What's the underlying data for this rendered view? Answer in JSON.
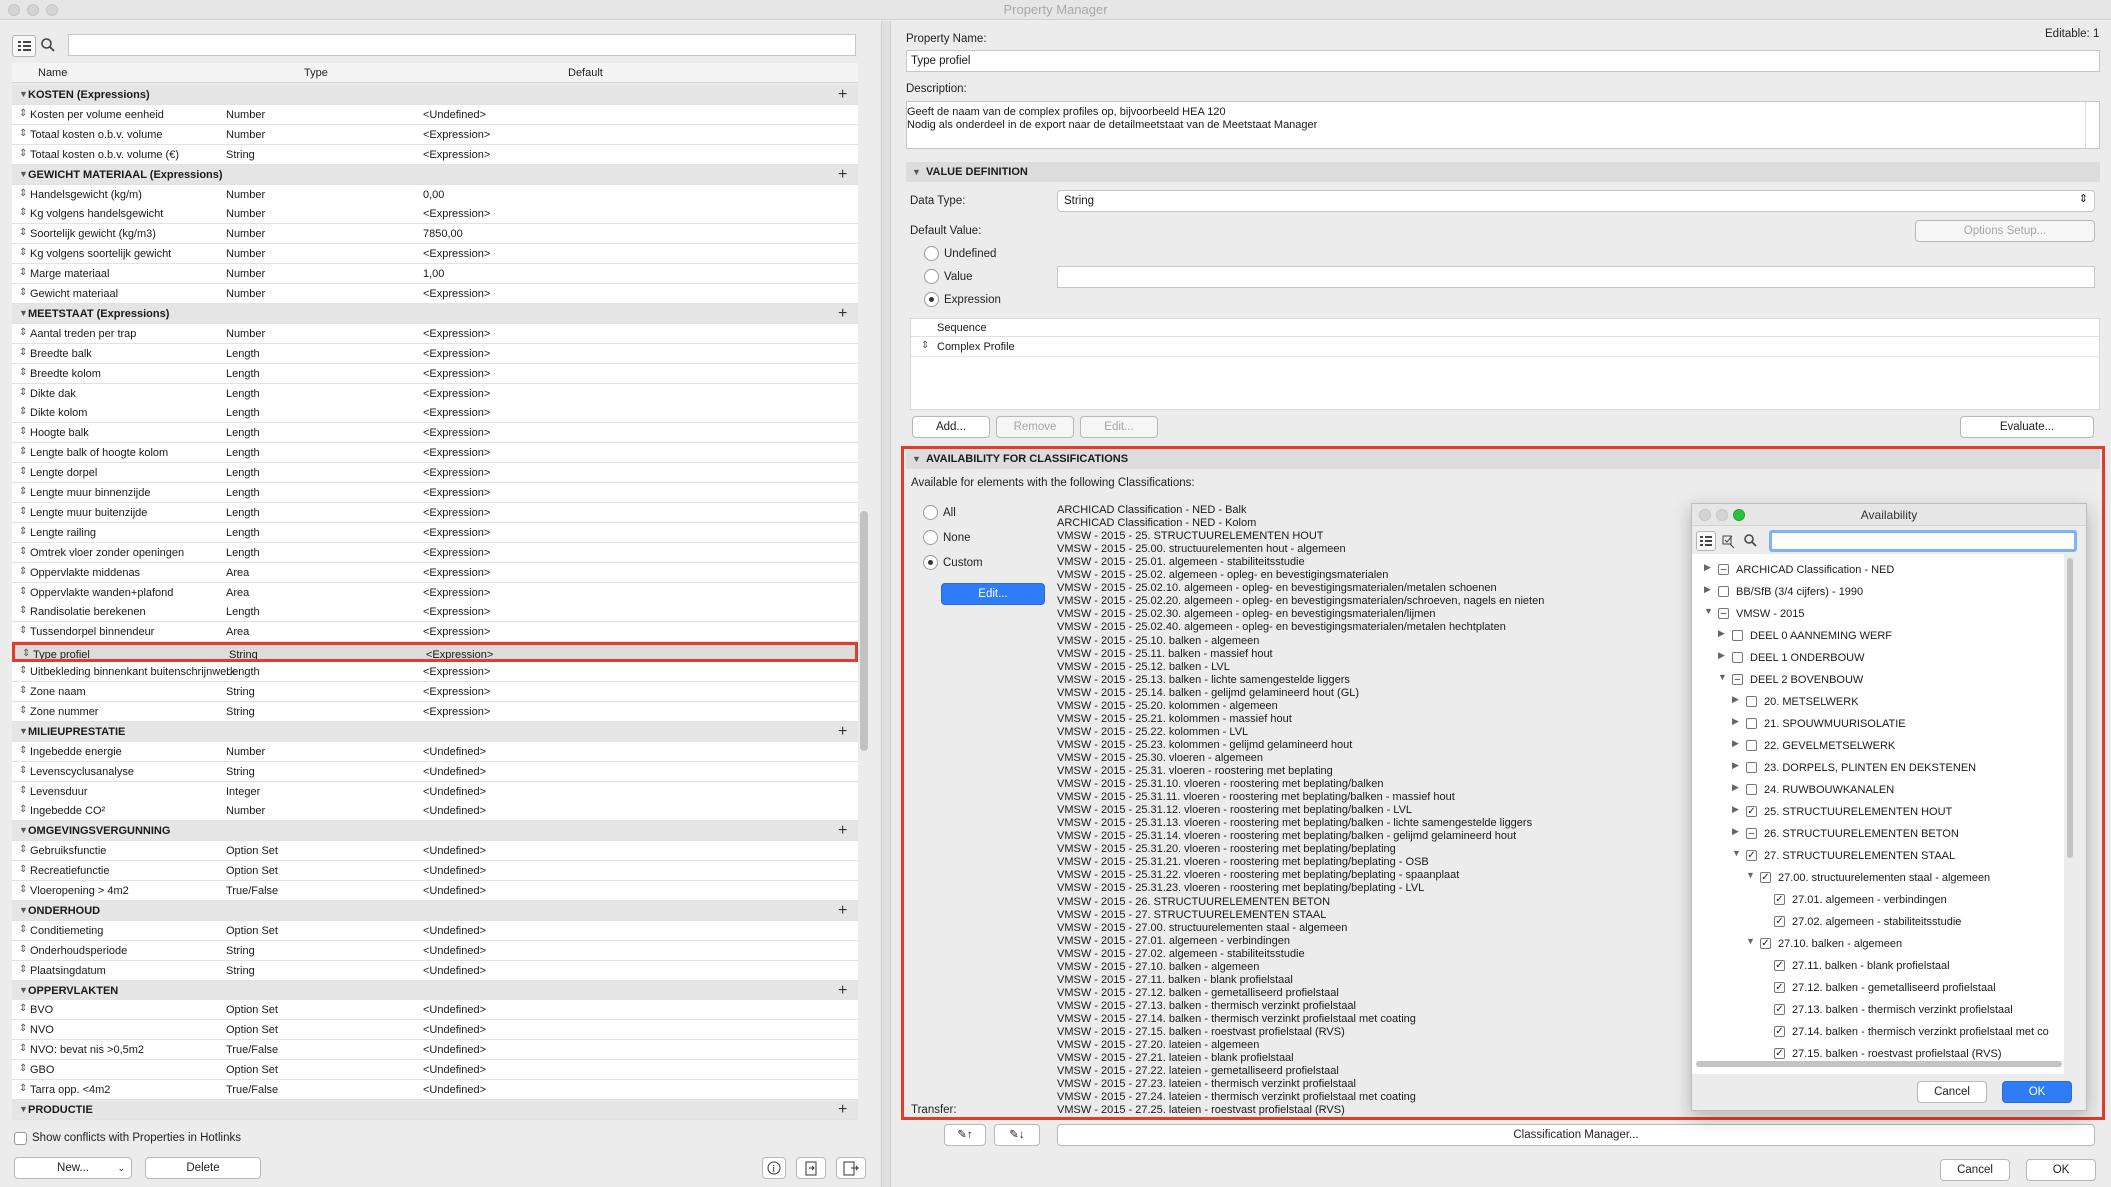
{
  "window": {
    "title": "Property Manager"
  },
  "left": {
    "columns": {
      "name": "Name",
      "type": "Type",
      "default": "Default"
    },
    "rows": [
      {
        "g": 1,
        "n": "KOSTEN (Expressions)"
      },
      {
        "n": "Kosten per volume eenheid",
        "t": "Number",
        "d": "<Undefined>"
      },
      {
        "n": "Totaal kosten o.b.v. volume",
        "t": "Number",
        "d": "<Expression>"
      },
      {
        "n": "Totaal kosten o.b.v. volume (€)",
        "t": "String",
        "d": "<Expression>"
      },
      {
        "g": 1,
        "n": "GEWICHT MATERIAAL (Expressions)"
      },
      {
        "n": "Handelsgewicht (kg/m)",
        "t": "Number",
        "d": "0,00"
      },
      {
        "n": "Kg volgens handelsgewicht",
        "t": "Number",
        "d": "<Expression>"
      },
      {
        "n": "Soortelijk gewicht (kg/m3)",
        "t": "Number",
        "d": "7850,00"
      },
      {
        "n": "Kg volgens soortelijk gewicht",
        "t": "Number",
        "d": "<Expression>"
      },
      {
        "n": "Marge materiaal",
        "t": "Number",
        "d": "1,00"
      },
      {
        "n": "Gewicht materiaal",
        "t": "Number",
        "d": "<Expression>"
      },
      {
        "g": 1,
        "n": "MEETSTAAT (Expressions)"
      },
      {
        "n": "Aantal treden per trap",
        "t": "Number",
        "d": "<Expression>"
      },
      {
        "n": "Breedte balk",
        "t": "Length",
        "d": "<Expression>"
      },
      {
        "n": "Breedte kolom",
        "t": "Length",
        "d": "<Expression>"
      },
      {
        "n": "Dikte dak",
        "t": "Length",
        "d": "<Expression>"
      },
      {
        "n": "Dikte kolom",
        "t": "Length",
        "d": "<Expression>"
      },
      {
        "n": "Hoogte balk",
        "t": "Length",
        "d": "<Expression>"
      },
      {
        "n": "Lengte balk of hoogte kolom",
        "t": "Length",
        "d": "<Expression>"
      },
      {
        "n": "Lengte dorpel",
        "t": "Length",
        "d": "<Expression>"
      },
      {
        "n": "Lengte muur binnenzijde",
        "t": "Length",
        "d": "<Expression>"
      },
      {
        "n": "Lengte muur buitenzijde",
        "t": "Length",
        "d": "<Expression>"
      },
      {
        "n": "Lengte railing",
        "t": "Length",
        "d": "<Expression>"
      },
      {
        "n": "Omtrek vloer zonder openingen",
        "t": "Length",
        "d": "<Expression>"
      },
      {
        "n": "Oppervlakte middenas",
        "t": "Area",
        "d": "<Expression>"
      },
      {
        "n": "Oppervlakte wanden+plafond",
        "t": "Area",
        "d": "<Expression>"
      },
      {
        "n": "Randisolatie berekenen",
        "t": "Length",
        "d": "<Expression>"
      },
      {
        "n": "Tussendorpel binnendeur",
        "t": "Area",
        "d": "<Expression>"
      },
      {
        "n": "Type profiel",
        "t": "String",
        "d": "<Expression>",
        "sel": 1
      },
      {
        "n": "Uitbekleding binnenkant buitenschrijnwerk",
        "t": "Length",
        "d": "<Expression>"
      },
      {
        "n": "Zone naam",
        "t": "String",
        "d": "<Expression>"
      },
      {
        "n": "Zone nummer",
        "t": "String",
        "d": "<Expression>"
      },
      {
        "g": 1,
        "n": "MILIEUPRESTATIE"
      },
      {
        "n": "Ingebedde energie",
        "t": "Number",
        "d": "<Undefined>"
      },
      {
        "n": "Levenscyclusanalyse",
        "t": "String",
        "d": "<Undefined>"
      },
      {
        "n": "Levensduur",
        "t": "Integer",
        "d": "<Undefined>"
      },
      {
        "n": "Ingebedde CO²",
        "t": "Number",
        "d": "<Undefined>"
      },
      {
        "g": 1,
        "n": "OMGEVINGSVERGUNNING"
      },
      {
        "n": "Gebruiksfunctie",
        "t": "Option Set",
        "d": "<Undefined>"
      },
      {
        "n": "Recreatiefunctie",
        "t": "Option Set",
        "d": "<Undefined>"
      },
      {
        "n": "Vloeropening > 4m2",
        "t": "True/False",
        "d": "<Undefined>"
      },
      {
        "g": 1,
        "n": "ONDERHOUD"
      },
      {
        "n": "Conditiemeting",
        "t": "Option Set",
        "d": "<Undefined>"
      },
      {
        "n": "Onderhoudsperiode",
        "t": "String",
        "d": "<Undefined>"
      },
      {
        "n": "Plaatsingdatum",
        "t": "String",
        "d": "<Undefined>"
      },
      {
        "g": 1,
        "n": "OPPERVLAKTEN"
      },
      {
        "n": "BVO",
        "t": "Option Set",
        "d": "<Undefined>"
      },
      {
        "n": "NVO",
        "t": "Option Set",
        "d": "<Undefined>"
      },
      {
        "n": "NVO: bevat nis >0,5m2",
        "t": "True/False",
        "d": "<Undefined>"
      },
      {
        "n": "GBO",
        "t": "Option Set",
        "d": "<Undefined>"
      },
      {
        "n": "Tarra opp. <4m2",
        "t": "True/False",
        "d": "<Undefined>"
      },
      {
        "g": 1,
        "n": "PRODUCTIE"
      }
    ],
    "show_conflicts": "Show conflicts with Properties in Hotlinks",
    "new_label": "New...",
    "delete_label": "Delete"
  },
  "right": {
    "editable": "Editable: 1",
    "property_name_label": "Property Name:",
    "property_name": "Type profiel",
    "description_label": "Description:",
    "description_1": "Geeft de naam van de complex profiles op, bijvoorbeeld HEA 120",
    "description_2": "Nodig als onderdeel in de export naar de detailmeetstaat van de Meetstaat Manager",
    "value_definition": "VALUE DEFINITION",
    "data_type_label": "Data Type:",
    "data_type": "String",
    "default_value_label": "Default Value:",
    "options_setup": "Options Setup...",
    "r_undefined": "Undefined",
    "r_value": "Value",
    "r_expression": "Expression",
    "seq_header": "Sequence",
    "seq_item": "Complex Profile",
    "add": "Add...",
    "remove": "Remove",
    "edit": "Edit...",
    "evaluate": "Evaluate...",
    "availability": "AVAILABILITY FOR CLASSIFICATIONS",
    "available_text": "Available for elements with the following Classifications:",
    "r_all": "All",
    "r_none": "None",
    "r_custom": "Custom",
    "edit_btn": "Edit...",
    "transfer": "Transfer:",
    "classification_manager": "Classification Manager...",
    "cancel": "Cancel",
    "ok": "OK",
    "classifications": [
      "ARCHICAD Classification - NED - Balk",
      "ARCHICAD Classification - NED - Kolom",
      "VMSW - 2015 - 25. STRUCTUURELEMENTEN HOUT",
      "VMSW - 2015 - 25.00. structuurelementen hout - algemeen",
      "VMSW - 2015 - 25.01. algemeen - stabiliteitsstudie",
      "VMSW - 2015 - 25.02. algemeen - opleg- en bevestigingsmaterialen",
      "VMSW - 2015 - 25.02.10. algemeen - opleg- en bevestigingsmaterialen/metalen schoenen",
      "VMSW - 2015 - 25.02.20. algemeen - opleg- en bevestigingsmaterialen/schroeven, nagels en nieten",
      "VMSW - 2015 - 25.02.30. algemeen - opleg- en bevestigingsmaterialen/lijmen",
      "VMSW - 2015 - 25.02.40. algemeen - opleg- en bevestigingsmaterialen/metalen hechtplaten",
      "VMSW - 2015 - 25.10. balken - algemeen",
      "VMSW - 2015 - 25.11. balken - massief hout",
      "VMSW - 2015 - 25.12. balken - LVL",
      "VMSW - 2015 - 25.13. balken - lichte samengestelde liggers",
      "VMSW - 2015 - 25.14. balken - gelijmd gelamineerd hout (GL)",
      "VMSW - 2015 - 25.20. kolommen - algemeen",
      "VMSW - 2015 - 25.21. kolommen - massief hout",
      "VMSW - 2015 - 25.22. kolommen - LVL",
      "VMSW - 2015 - 25.23. kolommen - gelijmd gelamineerd hout",
      "VMSW - 2015 - 25.30. vloeren - algemeen",
      "VMSW - 2015 - 25.31. vloeren - roostering met beplating",
      "VMSW - 2015 - 25.31.10. vloeren - roostering met beplating/balken",
      "VMSW - 2015 - 25.31.11. vloeren - roostering met beplating/balken - massief hout",
      "VMSW - 2015 - 25.31.12. vloeren - roostering met beplating/balken - LVL",
      "VMSW - 2015 - 25.31.13. vloeren - roostering met beplating/balken - lichte samengestelde liggers",
      "VMSW - 2015 - 25.31.14. vloeren - roostering met beplating/balken - gelijmd gelamineerd hout",
      "VMSW - 2015 - 25.31.20. vloeren - roostering met beplating/beplating",
      "VMSW - 2015 - 25.31.21. vloeren - roostering met beplating/beplating - OSB",
      "VMSW - 2015 - 25.31.22. vloeren - roostering met beplating/beplating - spaanplaat",
      "VMSW - 2015 - 25.31.23. vloeren - roostering met beplating/beplating - LVL",
      "VMSW - 2015 - 26. STRUCTUURELEMENTEN BETON",
      "VMSW - 2015 - 27. STRUCTUURELEMENTEN STAAL",
      "VMSW - 2015 - 27.00. structuurelementen staal - algemeen",
      "VMSW - 2015 - 27.01. algemeen - verbindingen",
      "VMSW - 2015 - 27.02. algemeen - stabiliteitsstudie",
      "VMSW - 2015 - 27.10. balken - algemeen",
      "VMSW - 2015 - 27.11. balken - blank profielstaal",
      "VMSW - 2015 - 27.12. balken - gemetalliseerd profielstaal",
      "VMSW - 2015 - 27.13. balken - thermisch verzinkt profielstaal",
      "VMSW - 2015 - 27.14. balken - thermisch verzinkt profielstaal met coating",
      "VMSW - 2015 - 27.15. balken - roestvast profielstaal (RVS)",
      "VMSW - 2015 - 27.20. lateien - algemeen",
      "VMSW - 2015 - 27.21. lateien - blank profielstaal",
      "VMSW - 2015 - 27.22. lateien - gemetalliseerd profielstaal",
      "VMSW - 2015 - 27.23. lateien - thermisch verzinkt profielstaal",
      "VMSW - 2015 - 27.24. lateien - thermisch verzinkt profielstaal met coating",
      "VMSW - 2015 - 27.25. lateien - roestvast profielstaal (RVS)"
    ]
  },
  "availability_dialog": {
    "title": "Availability",
    "cancel": "Cancel",
    "ok": "OK",
    "tree": [
      {
        "l": 0,
        "t": "▶",
        "c": "–",
        "x": "ARCHICAD Classification - NED"
      },
      {
        "l": 0,
        "t": "▶",
        "c": "",
        "x": "BB/SfB (3/4 cijfers) - 1990"
      },
      {
        "l": 0,
        "t": "▼",
        "c": "–",
        "x": "VMSW - 2015"
      },
      {
        "l": 1,
        "t": "▶",
        "c": "",
        "x": "DEEL 0 AANNEMING WERF"
      },
      {
        "l": 1,
        "t": "▶",
        "c": "",
        "x": "DEEL 1 ONDERBOUW"
      },
      {
        "l": 1,
        "t": "▼",
        "c": "–",
        "x": "DEEL 2 BOVENBOUW"
      },
      {
        "l": 2,
        "t": "▶",
        "c": "",
        "x": "20. METSELWERK"
      },
      {
        "l": 2,
        "t": "▶",
        "c": "",
        "x": "21. SPOUWMUURISOLATIE"
      },
      {
        "l": 2,
        "t": "▶",
        "c": "",
        "x": "22. GEVELMETSELWERK"
      },
      {
        "l": 2,
        "t": "▶",
        "c": "",
        "x": "23. DORPELS, PLINTEN EN DEKSTENEN"
      },
      {
        "l": 2,
        "t": "▶",
        "c": "",
        "x": "24. RUWBOUWKANALEN"
      },
      {
        "l": 2,
        "t": "▶",
        "c": "✓",
        "x": "25. STRUCTUURELEMENTEN HOUT"
      },
      {
        "l": 2,
        "t": "▶",
        "c": "–",
        "x": "26. STRUCTUURELEMENTEN BETON"
      },
      {
        "l": 2,
        "t": "▼",
        "c": "✓",
        "x": "27. STRUCTUURELEMENTEN STAAL"
      },
      {
        "l": 3,
        "t": "▼",
        "c": "✓",
        "x": "27.00. structuurelementen staal - algemeen"
      },
      {
        "l": 4,
        "t": "",
        "c": "✓",
        "x": "27.01. algemeen - verbindingen"
      },
      {
        "l": 4,
        "t": "",
        "c": "✓",
        "x": "27.02. algemeen - stabiliteitsstudie"
      },
      {
        "l": 3,
        "t": "▼",
        "c": "✓",
        "x": "27.10. balken - algemeen"
      },
      {
        "l": 4,
        "t": "",
        "c": "✓",
        "x": "27.11. balken - blank profielstaal"
      },
      {
        "l": 4,
        "t": "",
        "c": "✓",
        "x": "27.12. balken - gemetalliseerd profielstaal"
      },
      {
        "l": 4,
        "t": "",
        "c": "✓",
        "x": "27.13. balken - thermisch verzinkt profielstaal"
      },
      {
        "l": 4,
        "t": "",
        "c": "✓",
        "x": "27.14. balken - thermisch verzinkt profielstaal met co"
      },
      {
        "l": 4,
        "t": "",
        "c": "✓",
        "x": "27.15. balken - roestvast profielstaal (RVS)"
      }
    ]
  },
  "colors": {
    "accent": "#2e7cf6",
    "highlight": "#e33b2d"
  }
}
